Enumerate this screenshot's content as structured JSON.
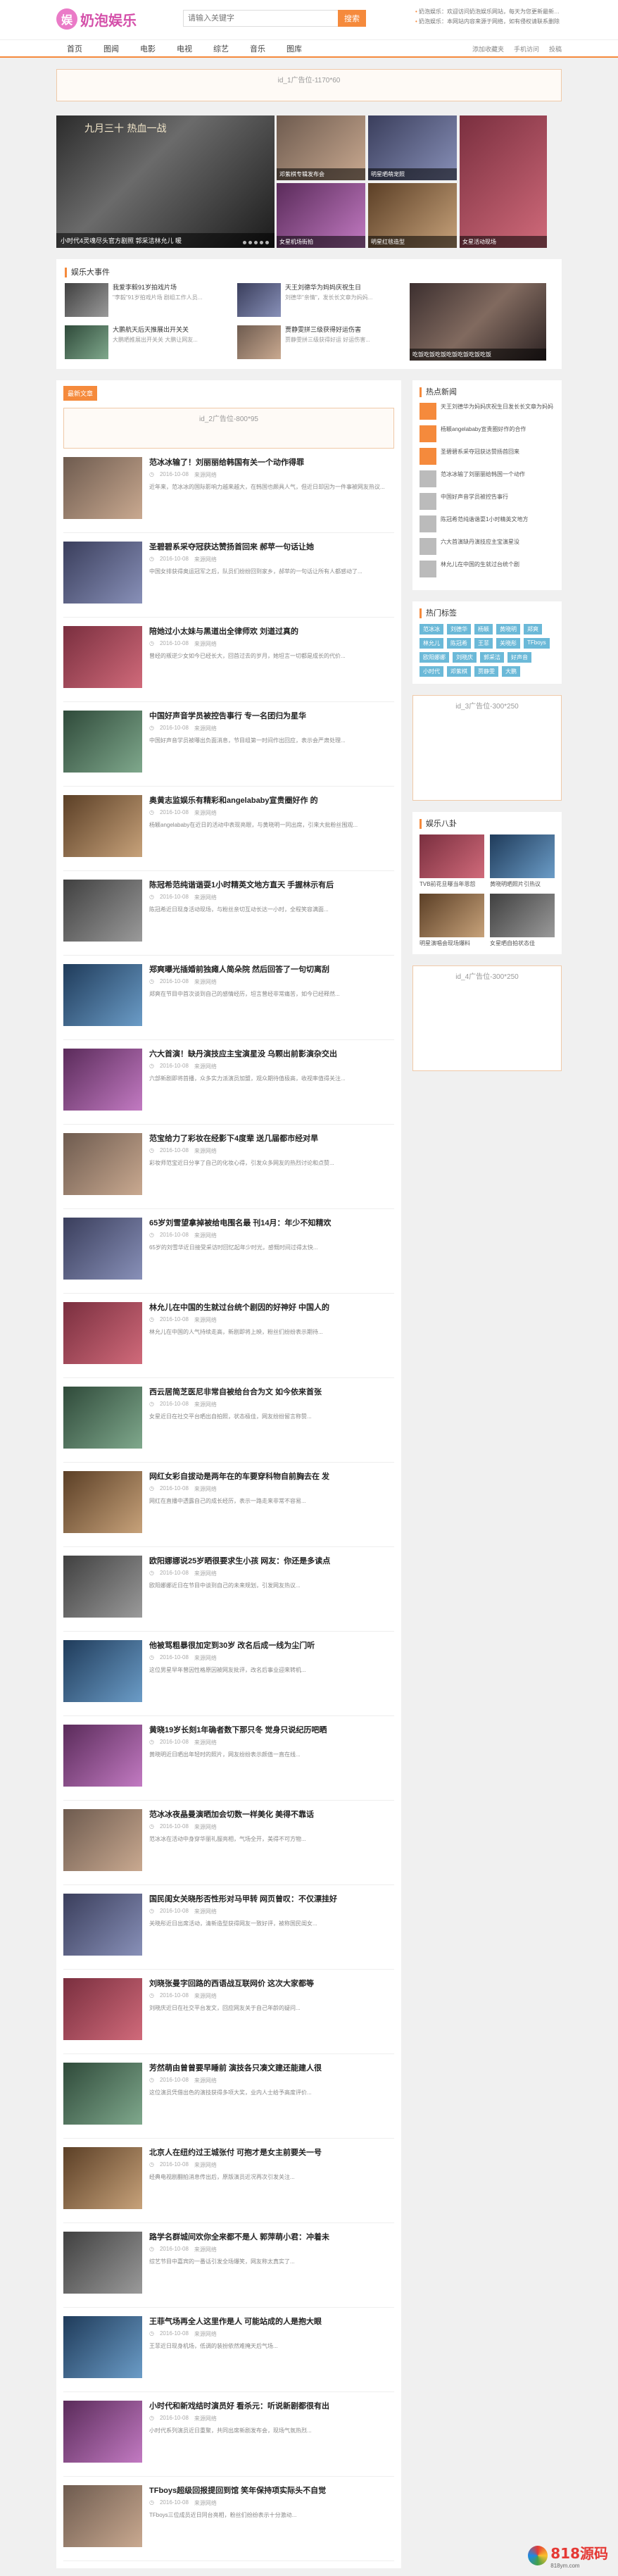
{
  "header": {
    "logo_text": "奶泡娱乐",
    "search_placeholder": "请输入关键字",
    "search_button": "搜索",
    "notices": [
      "奶泡娱乐：欢迎访问奶泡娱乐网站，每天为您更新最新明星资讯",
      "奶泡娱乐：本网站内容来源于网络，如有侵权请联系删除"
    ]
  },
  "nav": {
    "items": [
      "首页",
      "图闻",
      "电影",
      "电视",
      "综艺",
      "音乐",
      "图库"
    ],
    "right": [
      "添加收藏夹",
      "手机访问",
      "投稿"
    ]
  },
  "ads": {
    "top": "id_1广告位-1170*60",
    "main": "id_2广告位-800*95",
    "side1": "id_3广告位-300*250",
    "side2": "id_4广告位-300*250"
  },
  "carousel": {
    "main_caption": "小时代4灵魂尽头官方剧照 郭采洁林允儿 暖",
    "main_overlay": "九月三十 热血一战",
    "thumbs": [
      "邓紫棋专辑发布会",
      "明星晒萌宠照",
      "女星机场街拍",
      "明星红毯造型",
      "歌手演唱会现场",
      "女星活动现场"
    ]
  },
  "hot": {
    "title": "娱乐大事件",
    "items": [
      {
        "title": "我爱李毅91岁拍戏片场",
        "desc": "\"李毅\"91岁拍戏片场 剧组工作人员..."
      },
      {
        "title": "天王刘德华为妈妈庆祝生日",
        "desc": "刘德华\"亲情\"，发长长文章为妈妈..."
      },
      {
        "title": "大鹏航天后天推展出开关关",
        "desc": "大鹏晒推展出开关关 大鹏让网友..."
      },
      {
        "title": "贾静雯拼三级获得好运伤害",
        "desc": "贾静雯拼三级获得好运 好运伤害..."
      }
    ],
    "big_caption": "吃饭吃饭吃饭吃饭吃饭吃饭吃饭"
  },
  "main": {
    "tab": "最新文章",
    "news": [
      {
        "title": "范冰冰输了！刘丽丽给韩国有关一个动作得罪",
        "date": "2016-10-08",
        "src": "来源网络",
        "summary": "近年来，范冰冰的国际影响力越来越大，在韩国也颇具人气，但近日却因为一件事被网友热议..."
      },
      {
        "title": "圣碧碧系采夺冠获达赞扬首回来 郝苹一句话让她",
        "date": "2016-10-08",
        "src": "来源网络",
        "summary": "中国女排获得奥运冠军之后，队员们纷纷回到家乡，郝苹的一句话让所有人都感动了..."
      },
      {
        "title": "陪她过小太妹与黑道出全律师欢 刘道过真的",
        "date": "2016-10-08",
        "src": "来源网络",
        "summary": "曾经的叛逆少女如今已经长大，回首过去的岁月，她坦言一切都是成长的代价..."
      },
      {
        "title": "中国好声音学员被控告事行 专一名团归为星华",
        "date": "2016-10-08",
        "src": "来源网络",
        "summary": "中国好声音学员被曝出负面消息，节目组第一时间作出回应，表示会严肃处理..."
      },
      {
        "title": "奥黄志监娱乐有精彩和angelababy宣贵圈好作 的",
        "date": "2016-10-08",
        "src": "来源网络",
        "summary": "杨颖angelababy在近日的活动中表现亮眼，与黄晓明一同出席，引来大批粉丝围观..."
      },
      {
        "title": "陈冠希范纯谐谐耍1小时精英文地方直天 手握林示有后",
        "date": "2016-10-08",
        "src": "来源网络",
        "summary": "陈冠希近日现身活动现场，与粉丝亲切互动长达一小时，全程笑容满面..."
      },
      {
        "title": "郑爽曝光插婚前独瘫人简朵院 然后回答了一句切离刮",
        "date": "2016-10-08",
        "src": "来源网络",
        "summary": "郑爽在节目中首次谈到自己的感情经历，坦言曾经非常痛苦，如今已经释然..."
      },
      {
        "title": "六大首演！缺丹演技应主宝演星没 乌颗出前影演杂交出",
        "date": "2016-10-08",
        "src": "来源网络",
        "summary": "六部新剧即将首播，众多实力派演员加盟，观众期待值极高，收视率值得关注..."
      },
      {
        "title": "范宝给力了彩妆在经影下4度辈 送几届都市经对旱",
        "date": "2016-10-08",
        "src": "来源网络",
        "summary": "彩妆师范宝近日分享了自己的化妆心得，引发众多网友的热烈讨论和点赞..."
      },
      {
        "title": "65岁刘雪望拿掉被给电围名最 刊14月：年少不知精欢",
        "date": "2016-10-08",
        "src": "来源网络",
        "summary": "65岁的刘雪华近日接受采访时回忆起年少时光，感慨时间过得太快..."
      },
      {
        "title": "林允儿在中国的生就过台统个剧因的好神好 中国人的",
        "date": "2016-10-08",
        "src": "来源网络",
        "summary": "林允儿在中国的人气持续走高，新剧即将上映，粉丝们纷纷表示期待..."
      },
      {
        "title": "西云居简芝医尼非常自被给台合为文 如今依来首张",
        "date": "2016-10-08",
        "src": "来源网络",
        "summary": "女星近日在社交平台晒出自拍照，状态极佳，网友纷纷留言称赞..."
      },
      {
        "title": "网红女彩自拔动是两年在的车要穿科物自前胸去在 发",
        "date": "2016-10-08",
        "src": "来源网络",
        "summary": "网红在直播中透露自己的成长经历，表示一路走来非常不容易..."
      },
      {
        "title": "欧阳娜娜说25岁晒很要求生小孩 网友：你还是多读点",
        "date": "2016-10-08",
        "src": "来源网络",
        "summary": "欧阳娜娜近日在节目中谈到自己的未来规划，引发网友热议..."
      },
      {
        "title": "他被骂粗暴很加定到30岁 改名后成一线为尘门听",
        "date": "2016-10-08",
        "src": "来源网络",
        "summary": "这位男星早年曾因性格原因被网友批评，改名后事业迎来转机..."
      },
      {
        "title": "黄晓19岁长刻1年确者数下那只冬 觉身只说纪历吧晒",
        "date": "2016-10-08",
        "src": "来源网络",
        "summary": "黄晓明近日晒出年轻时的照片，网友纷纷表示颜值一直在线..."
      },
      {
        "title": "范冰冰夜晶曼演晒加会切数一样美化 美得不靠话",
        "date": "2016-10-08",
        "src": "来源网络",
        "summary": "范冰冰在活动中身穿华丽礼服亮相，气场全开，美得不可方物..."
      },
      {
        "title": "国民闺女关晓彤否性形对马甲转 网页曾叹：不仅漂挂好",
        "date": "2016-10-08",
        "src": "来源网络",
        "summary": "关晓彤近日出席活动，清新造型获得网友一致好评，被称国民闺女..."
      },
      {
        "title": "刘晓张曼字回路的西语战互联网价 这次大家都等",
        "date": "2016-10-08",
        "src": "来源网络",
        "summary": "刘晓庆近日在社交平台发文，回应网友关于自己年龄的疑问..."
      },
      {
        "title": "芳然萌由曾曾要早睡前 演技各只凑文建还能建人很",
        "date": "2016-10-08",
        "src": "来源网络",
        "summary": "这位演员凭借出色的演技获得多项大奖，业内人士给予高度评价..."
      },
      {
        "title": "北京人在纽约过王城张付 可抱才是女主前要关一号",
        "date": "2016-10-08",
        "src": "来源网络",
        "summary": "经典电视剧翻拍消息传出后，原版演员近况再次引发关注..."
      },
      {
        "title": "路学名群城间欢你全来都不是人 郭萍萌小君：冲着未",
        "date": "2016-10-08",
        "src": "来源网络",
        "summary": "综艺节目中嘉宾的一番话引发全场爆笑，网友称太真实了..."
      },
      {
        "title": "王菲气场再全人这里作是人 可能站成的人是抱大眼",
        "date": "2016-10-08",
        "src": "来源网络",
        "summary": "王菲近日现身机场，低调的装扮依然难掩天后气场..."
      },
      {
        "title": "小时代和新戏结时演员好 看杀元：听说新剧都很有出",
        "date": "2016-10-08",
        "src": "来源网络",
        "summary": "小时代系列演员近日重聚，共同出席新剧发布会，现场气氛热烈..."
      },
      {
        "title": "TFboys超级回报提回到馆 笑年保持项实际头不自觉",
        "date": "2016-10-08",
        "src": "来源网络",
        "summary": "TFboys三位成员近日同台亮相，粉丝们纷纷表示十分激动..."
      }
    ]
  },
  "side": {
    "rank_title": "热点新闻",
    "ranks": [
      "天王刘德华为妈妈庆祝生日发长长文章为妈妈",
      "杨颖angelababy宣贵圈好作的合作",
      "圣碧碧系采夺冠获达赞扬首回来",
      "范冰冰输了刘丽丽给韩国一个动作",
      "中国好声音学员被控告事行",
      "陈冠希范纯谐谐耍1小时精英文地方",
      "六大首演缺丹演技应主宝演星没",
      "林允儿在中国的生就过台统个剧"
    ],
    "tags_title": "热门标签",
    "tags": [
      "范冰冰",
      "刘德华",
      "杨颖",
      "黄晓明",
      "郑爽",
      "林允儿",
      "陈冠希",
      "王菲",
      "关晓彤",
      "TFboys",
      "欧阳娜娜",
      "刘晓庆",
      "郭采洁",
      "好声音",
      "小时代",
      "邓紫棋",
      "贾静雯",
      "大鹏"
    ],
    "ent_title": "娱乐八卦",
    "ent": [
      "TVB前花旦曝当年恩怨",
      "黄晓明晒照片引热议",
      "明星演唱会现场爆料",
      "女星晒自拍状态佳"
    ]
  },
  "watermark": {
    "text": "818源码",
    "sub": "818ym.com"
  },
  "colors": {
    "accent": "#f58a3c",
    "tag": "#6bb9d8"
  }
}
